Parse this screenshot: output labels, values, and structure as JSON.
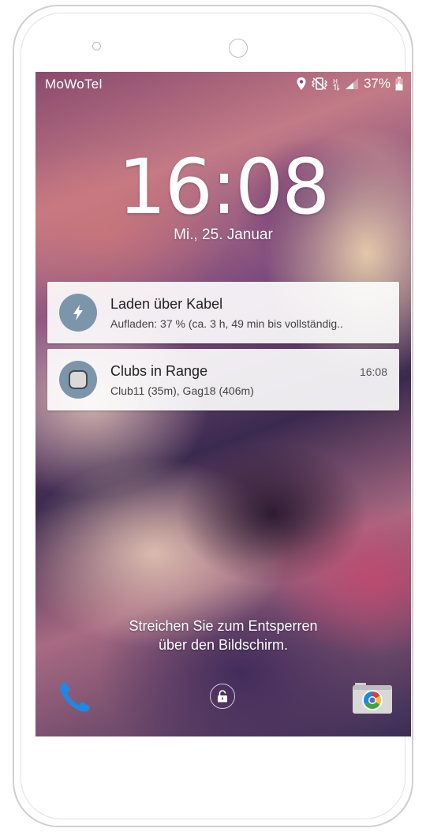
{
  "status_bar": {
    "carrier": "MoWoTel",
    "battery_percent": "37%",
    "icons": [
      "location-icon",
      "vibrate-icon",
      "hspa-icon",
      "signal-icon",
      "battery-charging-icon"
    ]
  },
  "lockscreen": {
    "time": "16:08",
    "date": "Mi., 25. Januar",
    "unlock_hint_line1": "Streichen Sie zum Entsperren",
    "unlock_hint_line2": "über den Bildschirm."
  },
  "notifications": [
    {
      "icon": "lightning-icon",
      "title": "Laden über Kabel",
      "text": "Aufladen: 37 % (ca. 3 h, 49 min bis vollständig..",
      "time": ""
    },
    {
      "icon": "app-square-icon",
      "title": "Clubs in Range",
      "text": "Club11 (35m), Gag18 (406m)",
      "time": "16:08"
    }
  ],
  "shortcuts": {
    "left": "phone-icon",
    "center": "lock-icon",
    "right": "camera-icon"
  },
  "colors": {
    "notification_icon_bg": "#7b95ab",
    "phone_icon": "#1e88e5"
  }
}
